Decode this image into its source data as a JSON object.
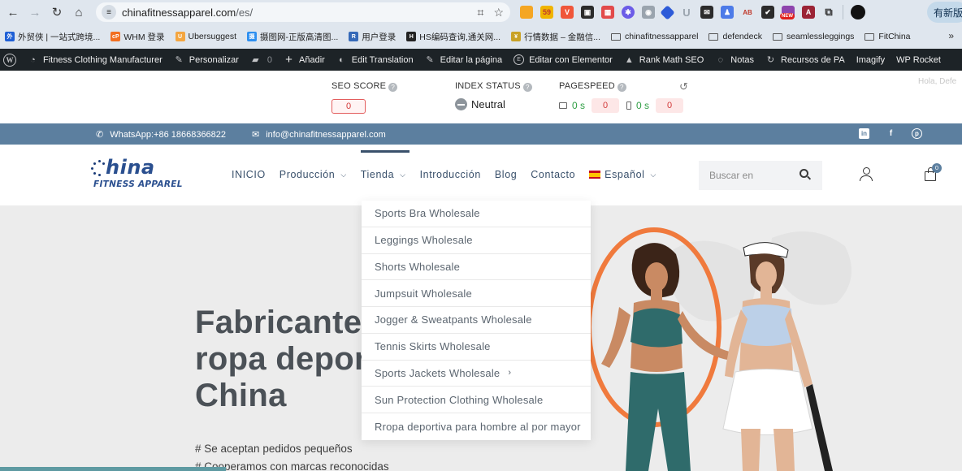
{
  "browser": {
    "url_domain": "chinafitnessapparel.com",
    "url_path": "/es/",
    "update_label": "有新版"
  },
  "bookmarks": [
    {
      "label": "外贸侠 | 一站式跨境...",
      "color": "#1e5fd6",
      "glyph": "外"
    },
    {
      "label": "WHM 登录",
      "color": "#f26f21",
      "glyph": "cP"
    },
    {
      "label": "Ubersuggest",
      "color": "#f4a640",
      "glyph": "U"
    },
    {
      "label": "摄图网-正版高清图...",
      "color": "#2d8ff0",
      "glyph": "摄"
    },
    {
      "label": "用户登录",
      "color": "#3569b8",
      "glyph": "R"
    },
    {
      "label": "HS编码查询,通关网...",
      "color": "#222222",
      "glyph": "H"
    },
    {
      "label": "行情数据 – 金融信...",
      "color": "#c9a227",
      "glyph": "¥"
    }
  ],
  "bookmark_folders": [
    "chinafitnessapparel",
    "defendeck",
    "seamlessleggings",
    "FitChina"
  ],
  "wpbar": {
    "site": "Fitness Clothing Manufacturer",
    "customize": "Personalizar",
    "comments": "0",
    "add_new": "Añadir",
    "translation": "Edit Translation",
    "edit_page": "Editar la página",
    "elementor": "Editar con Elementor",
    "rankmath": "Rank Math SEO",
    "notes": "Notas",
    "pa": "Recursos de PA",
    "imagify": "Imagify",
    "rocket": "WP Rocket"
  },
  "seo": {
    "score_label": "SEO SCORE",
    "score_value": "0",
    "index_label": "INDEX STATUS",
    "index_value": "Neutral",
    "pagespeed_label": "PAGESPEED",
    "desktop_time": "0 s",
    "desktop_score": "0",
    "mobile_time": "0 s",
    "mobile_score": "0",
    "greeting": "Hola, Defe"
  },
  "topbar": {
    "whatsapp": "WhatsApp:+86 18668366822",
    "email": "info@chinafitnessapparel.com"
  },
  "logo": {
    "word": "hina",
    "sub": "FITNESS APPAREL"
  },
  "menu": {
    "inicio": "INICIO",
    "produccion": "Producción",
    "tienda": "Tienda",
    "introduccion": "Introducción",
    "blog": "Blog",
    "contacto": "Contacto",
    "idioma": "Español"
  },
  "search": {
    "placeholder": "Buscar en"
  },
  "cart": {
    "count": "0"
  },
  "dropdown": [
    "Sports Bra Wholesale",
    "Leggings Wholesale",
    "Shorts Wholesale",
    "Jumpsuit Wholesale",
    "Jogger & Sweatpants Wholesale",
    "Tennis Skirts Wholesale",
    "Sports Jackets Wholesale",
    "Sun Protection Clothing Wholesale",
    "Rropa deportiva para hombre al por mayor"
  ],
  "hero": {
    "line1": "Fabricante",
    "line2": "ropa depor",
    "line3": "China",
    "bullet1": "# Se aceptan pedidos pequeños",
    "bullet2": "# Cooperamos con marcas reconocidas"
  },
  "colors": {
    "topbar": "#5c7f9f",
    "menu_text": "#39506b",
    "hero_bg": "#ececec",
    "wp_admin": "#1d2327"
  }
}
